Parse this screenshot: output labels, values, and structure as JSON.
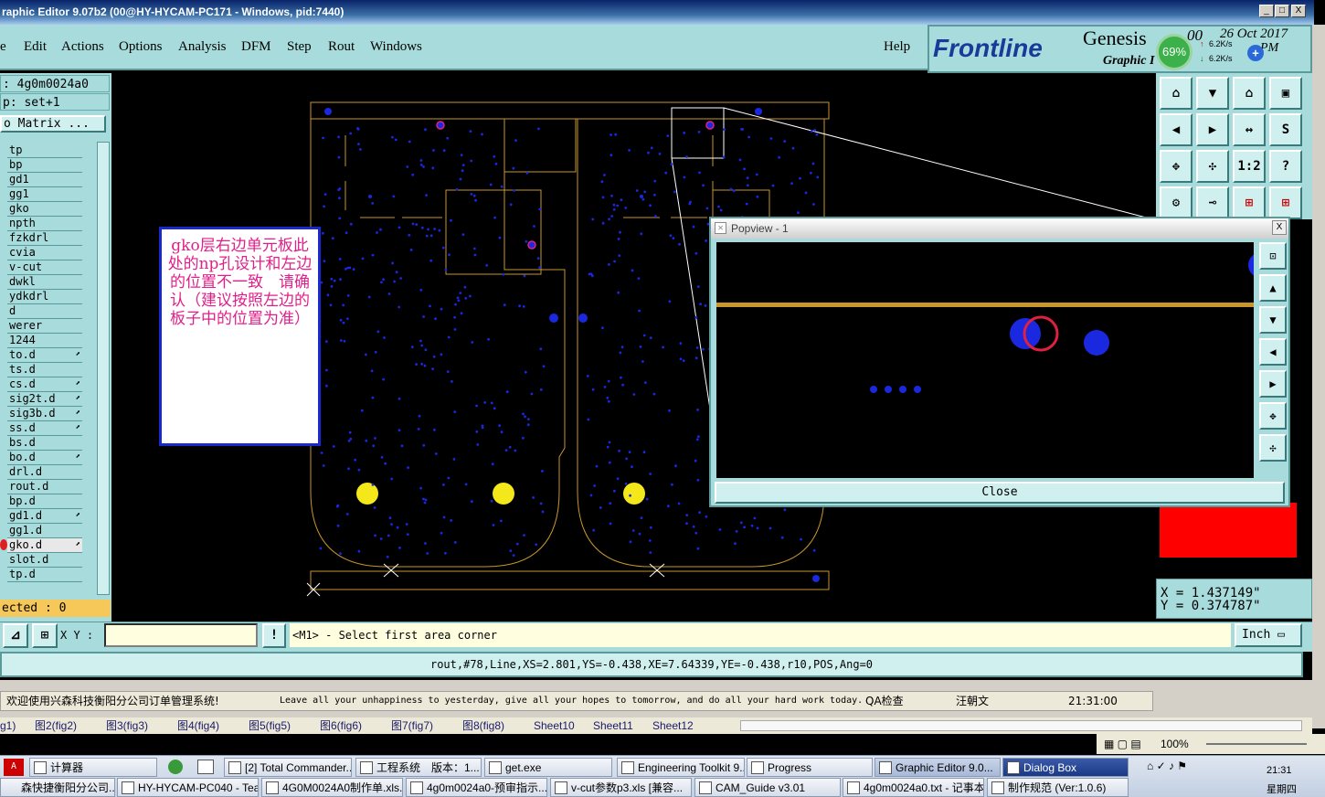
{
  "window": {
    "title": "raphic Editor 9.07b2 (00@HY-HYCAM-PC171 - Windows, pid:7440)",
    "min": "_",
    "max": "□",
    "close": "X"
  },
  "menu": {
    "items": [
      "e",
      "Edit",
      "Actions",
      "Options",
      "Analysis",
      "DFM",
      "Step",
      "Rout",
      "Windows"
    ],
    "help": "Help"
  },
  "brand": {
    "logo": "Frontline",
    "product": "Genesis",
    "version_tail": "00",
    "date": "26 Oct 2017",
    "ampm": "PM",
    "subtitle": "Graphic I",
    "net_pct": "69%",
    "up_speed": "6.2K/s",
    "down_speed": "6.2K/s"
  },
  "left_panel": {
    "job": ": 4g0m0024a0",
    "step": "p: set+1",
    "matrix": "o Matrix ...",
    "layers": [
      {
        "name": "tp",
        "arrow": false
      },
      {
        "name": "bp",
        "arrow": false
      },
      {
        "name": "gd1",
        "arrow": false
      },
      {
        "name": "gg1",
        "arrow": false
      },
      {
        "name": "gko",
        "arrow": false
      },
      {
        "name": "npth",
        "arrow": false
      },
      {
        "name": "fzkdrl",
        "arrow": false
      },
      {
        "name": "cvia",
        "arrow": false
      },
      {
        "name": "v-cut",
        "arrow": false
      },
      {
        "name": "dwkl",
        "arrow": false
      },
      {
        "name": "ydkdrl",
        "arrow": false
      },
      {
        "name": "d",
        "arrow": false
      },
      {
        "name": "werer",
        "arrow": false
      },
      {
        "name": "1244",
        "arrow": false
      },
      {
        "name": "to.d",
        "arrow": true
      },
      {
        "name": "ts.d",
        "arrow": false
      },
      {
        "name": "cs.d",
        "arrow": true
      },
      {
        "name": "sig2t.d",
        "arrow": true
      },
      {
        "name": "sig3b.d",
        "arrow": true
      },
      {
        "name": "ss.d",
        "arrow": true
      },
      {
        "name": "bs.d",
        "arrow": false
      },
      {
        "name": "bo.d",
        "arrow": true
      },
      {
        "name": "drl.d",
        "arrow": false
      },
      {
        "name": "rout.d",
        "arrow": false
      },
      {
        "name": "bp.d",
        "arrow": false
      },
      {
        "name": "gd1.d",
        "arrow": true
      },
      {
        "name": "gg1.d",
        "arrow": false
      },
      {
        "name": "gko.d",
        "arrow": true
      },
      {
        "name": "slot.d",
        "arrow": false
      },
      {
        "name": "tp.d",
        "arrow": false
      }
    ],
    "selected": "ected : 0"
  },
  "note": "gko层右边单元板此处的np孔设计和左边的位置不一致　请确认（建议按照左边的板子中的位置为准）",
  "popview": {
    "title": "Popview - 1",
    "close_x": "X",
    "close_label": "Close"
  },
  "toolbox": {
    "ratio_label": "1:2",
    "help_label": "?"
  },
  "coords": {
    "x": "X = 1.437149\"",
    "y": "Y = 0.374787\""
  },
  "command": {
    "xy_label": "X Y :",
    "xy_value": "",
    "excl": "!",
    "prompt": "<M1> - Select first area corner",
    "units": "Inch"
  },
  "status_line": "rout,#78,Line,XS=2.801,YS=-0.438,XE=7.64339,YE=-0.438,r10,POS,Ang=0",
  "info_bar": {
    "welcome": "欢迎使用兴森科技衡阳分公司订单管理系统!",
    "motto": "Leave all your unhappiness to yesterday, give all your hopes to tomorrow, and do all your hard work today.",
    "qa": "QA检查",
    "user": "汪朝文",
    "time": "21:31:00"
  },
  "sheets": [
    "g1)",
    "图2(fig2)",
    "图3(fig3)",
    "图4(fig4)",
    "图5(fig5)",
    "图6(fig6)",
    "图7(fig7)",
    "图8(fig8)",
    "Sheet10",
    "Sheet11",
    "Sheet12"
  ],
  "excel_zoom": "100%",
  "taskbar": {
    "row1": [
      "计算器",
      "[2] Total Commander...",
      "工程系统　版本：1...",
      "get.exe",
      "Engineering Toolkit 9...",
      "Progress",
      "Graphic Editor 9.0...",
      "Dialog Box"
    ],
    "row2": [
      "森快捷衡阳分公司...",
      "HY-HYCAM-PC040 - Tea...",
      "4G0M0024A0制作单.xls...",
      "4g0m0024a0-预审指示...",
      "v-cut参数p3.xls [兼容...",
      "CAM_Guide v3.01",
      "4g0m0024a0.txt - 记事本",
      "制作规范 (Ver:1.0.6)"
    ],
    "clock": "21:31",
    "weekday": "星期四"
  },
  "colors": {
    "panel": "#a8dcdc",
    "outline": "#c8962a",
    "pad_blue": "#1a28e0",
    "pad_yellow": "#f5e81a",
    "note_border": "#1a28d0",
    "note_text": "#e0208a"
  }
}
